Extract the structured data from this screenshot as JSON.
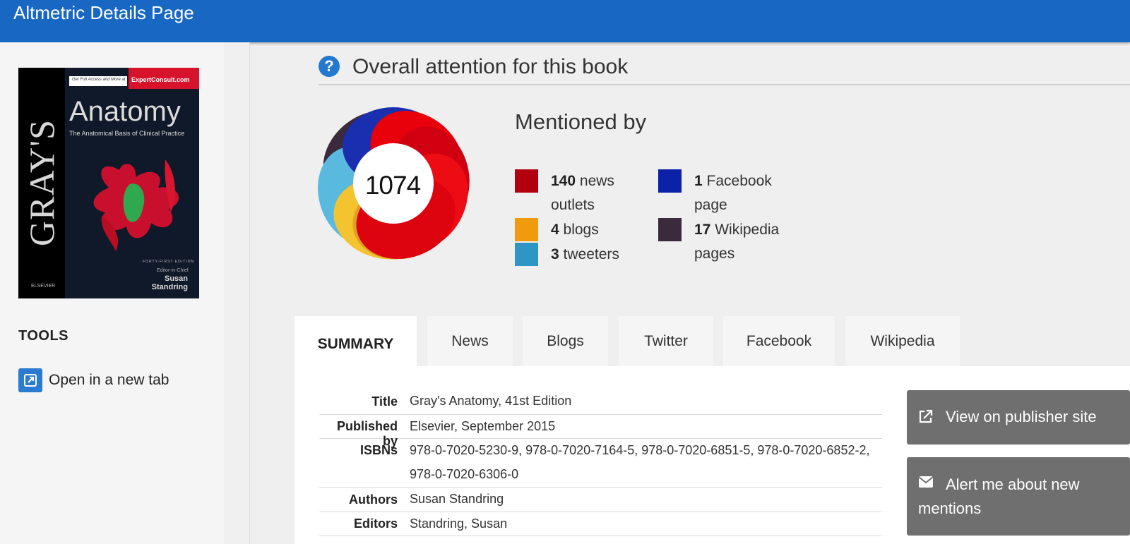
{
  "header": {
    "title": "Altmetric Details Page"
  },
  "sidebar": {
    "cover": {
      "spine_text": "GRAY'S",
      "title": "Anatomy",
      "subtitle": "The Anatomical Basis of Clinical Practice",
      "promo_small": "Get Full Access and More at",
      "promo_site": "ExpertConsult.com",
      "edition": "FORTY-FIRST EDITION",
      "editor_in_chief": "Editor-in-Chief",
      "editor_name": "Susan Standring",
      "publisher": "ELSEVIER"
    },
    "tools_heading": "TOOLS",
    "tools": [
      {
        "label": "Open in a new tab",
        "icon": "external-link-icon"
      }
    ]
  },
  "attention": {
    "heading": "Overall attention for this book",
    "score": "1074",
    "mentioned_by": "Mentioned by",
    "sources": [
      {
        "count": "140",
        "label": "news",
        "label2": "outlets",
        "color": "#b3000f"
      },
      {
        "count": "4",
        "label": "blogs",
        "label2": "",
        "color": "#f09a0c"
      },
      {
        "count": "3",
        "label": "tweeters",
        "label2": "",
        "color": "#2e95c4"
      },
      {
        "count": "1",
        "label": "Facebook",
        "label2": "page",
        "color": "#0a21a8"
      },
      {
        "count": "17",
        "label": "Wikipedia",
        "label2": "pages",
        "color": "#3a2a3c"
      }
    ]
  },
  "tabs": [
    {
      "label": "SUMMARY",
      "active": true
    },
    {
      "label": "News"
    },
    {
      "label": "Blogs"
    },
    {
      "label": "Twitter"
    },
    {
      "label": "Facebook"
    },
    {
      "label": "Wikipedia"
    }
  ],
  "summary": {
    "rows": [
      {
        "label": "Title",
        "value": "Gray's Anatomy, 41st Edition"
      },
      {
        "label": "Published by",
        "value": "Elsevier, September 2015"
      },
      {
        "label": "ISBNs",
        "value": "978-0-7020-5230-9, 978-0-7020-7164-5, 978-0-7020-6851-5, 978-0-7020-6852-2, 978-0-7020-6306-0"
      },
      {
        "label": "Authors",
        "value": "Susan Standring"
      },
      {
        "label": "Editors",
        "value": "Standring, Susan"
      }
    ]
  },
  "actions": [
    {
      "label": "View on publisher site",
      "icon": "external-link-icon"
    },
    {
      "label": "Alert me about new mentions",
      "icon": "envelope-icon"
    }
  ],
  "colors": {
    "header": "#1767c3",
    "button": "#6f6f6f",
    "help": "#2379cf"
  }
}
